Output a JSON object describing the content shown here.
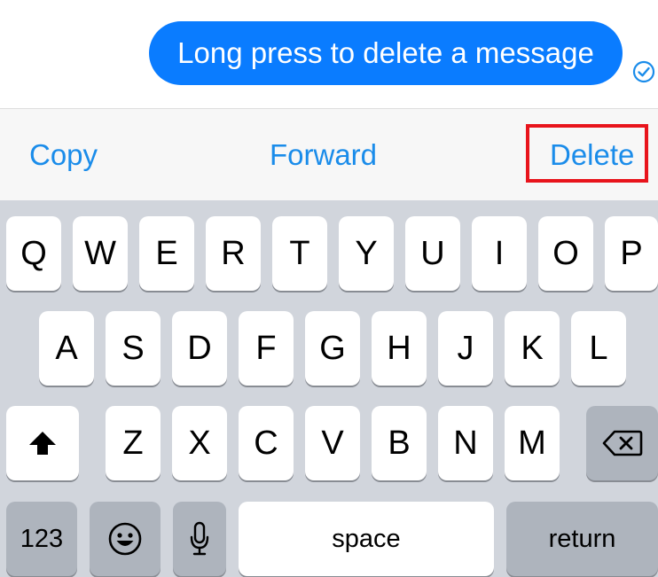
{
  "conversation": {
    "message_text": "Long press to delete a message",
    "bubble_color": "#0a7cff"
  },
  "action_bar": {
    "copy_label": "Copy",
    "forward_label": "Forward",
    "delete_label": "Delete",
    "action_color": "#1a8cea",
    "highlight_color": "#e8141c"
  },
  "keyboard": {
    "row1": [
      "Q",
      "W",
      "E",
      "R",
      "T",
      "Y",
      "U",
      "I",
      "O",
      "P"
    ],
    "row2": [
      "A",
      "S",
      "D",
      "F",
      "G",
      "H",
      "J",
      "K",
      "L"
    ],
    "row3": [
      "Z",
      "X",
      "C",
      "V",
      "B",
      "N",
      "M"
    ],
    "shift_icon": "shift-arrow-icon",
    "backspace_icon": "backspace-icon",
    "numbers_label": "123",
    "emoji_icon": "emoji-icon",
    "mic_icon": "microphone-icon",
    "space_label": "space",
    "return_label": "return"
  },
  "icons": {
    "delivered_icon": "check-circle-icon"
  }
}
